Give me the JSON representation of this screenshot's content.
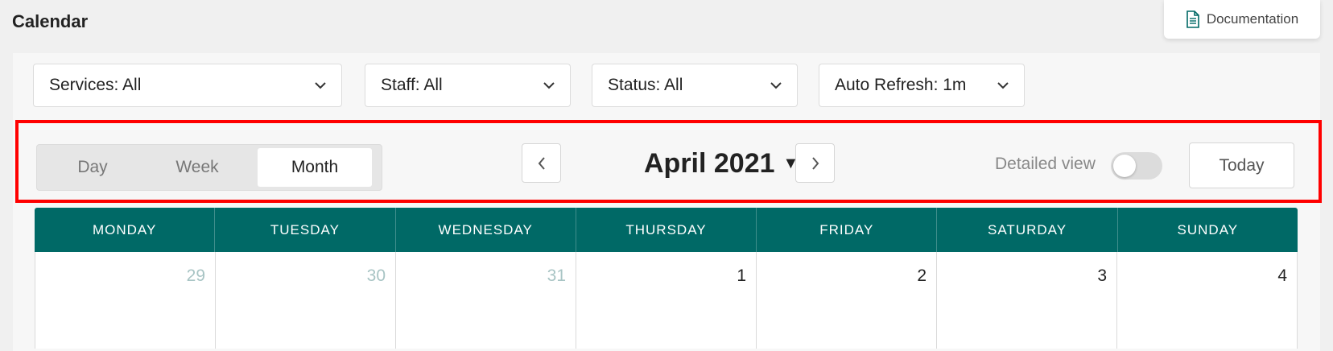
{
  "header": {
    "title": "Calendar",
    "documentation_label": "Documentation"
  },
  "filters": [
    {
      "label": "Services: All"
    },
    {
      "label": "Staff: All"
    },
    {
      "label": "Status: All"
    },
    {
      "label": "Auto Refresh: 1m"
    }
  ],
  "toolbar": {
    "views": [
      "Day",
      "Week",
      "Month"
    ],
    "active_view": "Month",
    "month_label": "April 2021",
    "detailed_view_label": "Detailed view",
    "detailed_view_on": false,
    "today_label": "Today"
  },
  "calendar": {
    "weekdays": [
      "MONDAY",
      "TUESDAY",
      "WEDNESDAY",
      "THURSDAY",
      "FRIDAY",
      "SATURDAY",
      "SUNDAY"
    ],
    "first_week": [
      {
        "day": "29",
        "other_month": true
      },
      {
        "day": "30",
        "other_month": true
      },
      {
        "day": "31",
        "other_month": true
      },
      {
        "day": "1",
        "other_month": false
      },
      {
        "day": "2",
        "other_month": false
      },
      {
        "day": "3",
        "other_month": false
      },
      {
        "day": "4",
        "other_month": false
      }
    ]
  },
  "colors": {
    "header_teal": "#006966",
    "highlight_red": "#ff0000",
    "other_month_day": "#a8c4c4"
  }
}
